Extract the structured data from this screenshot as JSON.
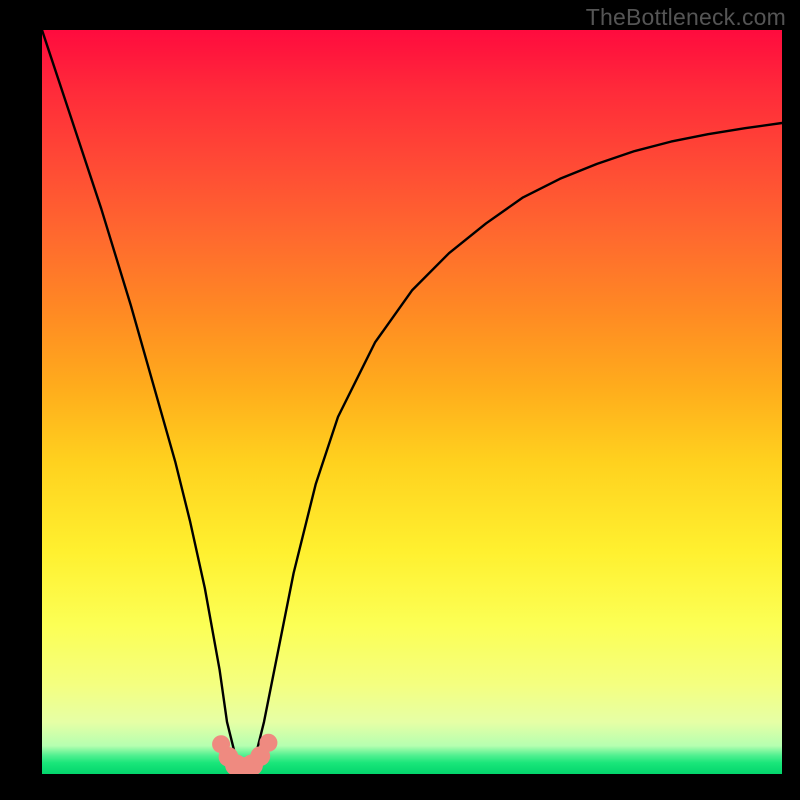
{
  "attribution": "TheBottleneck.com",
  "chart_data": {
    "type": "line",
    "title": "",
    "xlabel": "",
    "ylabel": "",
    "xlim": [
      0,
      100
    ],
    "ylim": [
      0,
      100
    ],
    "series": [
      {
        "name": "curve",
        "x": [
          0,
          4,
          8,
          12,
          16,
          18,
          20,
          22,
          24,
          25,
          26,
          27,
          27.3,
          28,
          29,
          30,
          32,
          34,
          37,
          40,
          45,
          50,
          55,
          60,
          65,
          70,
          75,
          80,
          85,
          90,
          95,
          100
        ],
        "y": [
          100,
          88,
          76,
          63,
          49,
          42,
          34,
          25,
          14,
          7,
          3,
          1,
          0.6,
          1,
          3,
          7,
          17,
          27,
          39,
          48,
          58,
          65,
          70,
          74,
          77.5,
          80,
          82,
          83.7,
          85,
          86,
          86.8,
          87.5
        ]
      }
    ],
    "markers": {
      "name": "peaches",
      "color": "#ef8a80",
      "radius_base": 9,
      "points": [
        {
          "x": 24.2,
          "y": 4.0
        },
        {
          "x": 25.2,
          "y": 2.3
        },
        {
          "x": 26.2,
          "y": 1.2
        },
        {
          "x": 27.3,
          "y": 0.7
        },
        {
          "x": 28.4,
          "y": 1.2
        },
        {
          "x": 29.5,
          "y": 2.4
        },
        {
          "x": 30.6,
          "y": 4.2
        }
      ]
    }
  }
}
